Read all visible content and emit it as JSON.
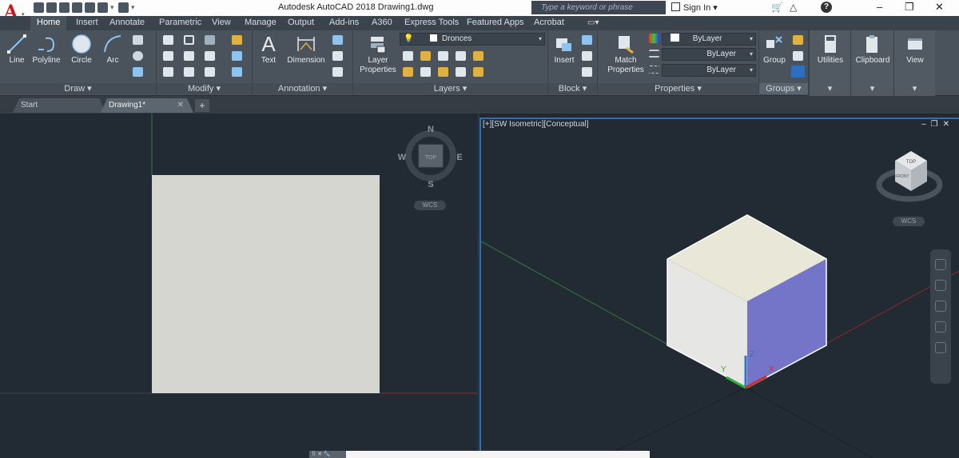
{
  "title": "Autodesk AutoCAD 2018    Drawing1.dwg",
  "search": {
    "placeholder": "Type a keyword or phrase"
  },
  "user": {
    "sign_in": "Sign In"
  },
  "tabs": [
    "Home",
    "Insert",
    "Annotate",
    "Parametric",
    "View",
    "Manage",
    "Output",
    "Add-ins",
    "A360",
    "Express Tools",
    "Featured Apps",
    "Acrobat"
  ],
  "ribbon": {
    "draw": {
      "title": "Draw",
      "line": "Line",
      "polyline": "Polyline",
      "circle": "Circle",
      "arc": "Arc"
    },
    "modify": {
      "title": "Modify"
    },
    "annotation": {
      "title": "Annotation",
      "text": "Text",
      "dimension": "Dimension"
    },
    "layers": {
      "title": "Layers",
      "layer_properties": "Layer\nProperties",
      "current_layer": "Dronces"
    },
    "block": {
      "title": "Block",
      "insert": "Insert"
    },
    "properties": {
      "title": "Properties",
      "match": "Match\nProperties",
      "color": "ByLayer",
      "linetype": "ByLayer",
      "lineweight": "ByLayer"
    },
    "groups": {
      "title": "Groups",
      "group": "Group"
    },
    "utilities": {
      "label": "Utilities"
    },
    "clipboard": {
      "label": "Clipboard"
    },
    "view": {
      "label": "View"
    }
  },
  "doc_tabs": {
    "start": "Start",
    "drawing": "Drawing1*"
  },
  "viewports": {
    "left": {
      "compass": {
        "n": "N",
        "s": "S",
        "e": "E",
        "w": "W",
        "top": "TOP"
      },
      "wcs": "WCS"
    },
    "right": {
      "label": "[+][SW Isometric][Conceptual]",
      "wcs": "WCS",
      "axis_z": "Z",
      "axis_y": "Y",
      "axis_x": "X",
      "cube_faces": {
        "top": "TOP",
        "front": "FRONT"
      }
    }
  },
  "colors": {
    "accent": "#2d6fbf",
    "cube_right": "#7474c8",
    "cube_top": "#e9e8d8",
    "cube_left": "#e6e6e4",
    "square": "#d6d6d1",
    "background": "#222a33"
  }
}
